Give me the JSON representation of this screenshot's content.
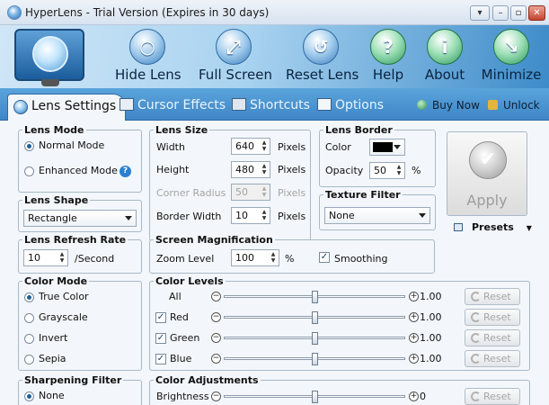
{
  "window": {
    "title": "HyperLens - Trial Version (Expires in 30 days)",
    "btn_menu": "▾",
    "btn_min": "–",
    "btn_max": "▫",
    "btn_close": "✕"
  },
  "toolbar": {
    "items": [
      {
        "label": "Hide Lens",
        "icon": "magnifier-icon",
        "glyph": "○"
      },
      {
        "label": "Full Screen",
        "icon": "fullscreen-icon",
        "glyph": "⤢"
      },
      {
        "label": "Reset Lens",
        "icon": "reset-icon",
        "glyph": "↺"
      },
      {
        "label": "Help",
        "icon": "help-icon",
        "glyph": "?"
      },
      {
        "label": "About",
        "icon": "info-icon",
        "glyph": "i"
      },
      {
        "label": "Minimize",
        "icon": "minimize-icon",
        "glyph": "↘"
      }
    ]
  },
  "tabs": {
    "items": [
      "Lens Settings",
      "Cursor Effects",
      "Shortcuts",
      "Options"
    ],
    "active": "Lens Settings",
    "buy_now": "Buy Now",
    "unlock": "Unlock"
  },
  "lens_mode": {
    "title": "Lens Mode",
    "normal": "Normal Mode",
    "enhanced": "Enhanced Mode",
    "selected": "Normal Mode"
  },
  "lens_size": {
    "title": "Lens Size",
    "width_label": "Width",
    "width_value": "640",
    "width_unit": "Pixels",
    "height_label": "Height",
    "height_value": "480",
    "height_unit": "Pixels",
    "corner_label": "Corner Radius",
    "corner_value": "50",
    "corner_unit": "Pixels",
    "border_label": "Border Width",
    "border_value": "10",
    "border_unit": "Pixels"
  },
  "lens_border": {
    "title": "Lens Border",
    "color_label": "Color",
    "color_value": "#000000",
    "opacity_label": "Opacity",
    "opacity_value": "50",
    "opacity_unit": "%"
  },
  "apply": {
    "label": "Apply",
    "presets": "Presets"
  },
  "lens_shape": {
    "title": "Lens Shape",
    "value": "Rectangle"
  },
  "texture_filter": {
    "title": "Texture Filter",
    "value": "None"
  },
  "refresh": {
    "title": "Lens Refresh Rate",
    "value": "10",
    "unit": "/Second"
  },
  "magnification": {
    "title": "Screen Magnification",
    "zoom_label": "Zoom Level",
    "zoom_value": "100",
    "zoom_unit": "%",
    "smoothing": "Smoothing",
    "smoothing_checked": true
  },
  "color_mode": {
    "title": "Color Mode",
    "options": [
      "True Color",
      "Grayscale",
      "Invert",
      "Sepia"
    ],
    "selected": "True Color"
  },
  "color_levels": {
    "title": "Color Levels",
    "rows": [
      {
        "label": "All",
        "value": "1.00",
        "checkbox": false,
        "level": 0.5
      },
      {
        "label": "Red",
        "value": "1.00",
        "checkbox": true,
        "level": 0.5
      },
      {
        "label": "Green",
        "value": "1.00",
        "checkbox": true,
        "level": 0.5
      },
      {
        "label": "Blue",
        "value": "1.00",
        "checkbox": true,
        "level": 0.5
      }
    ],
    "reset": "Reset"
  },
  "sharpening": {
    "title": "Sharpening Filter",
    "option": "None"
  },
  "color_adjust": {
    "title": "Color Adjustments",
    "brightness_label": "Brightness",
    "brightness_value": "0",
    "brightness_level": 0.5,
    "reset": "Reset"
  }
}
